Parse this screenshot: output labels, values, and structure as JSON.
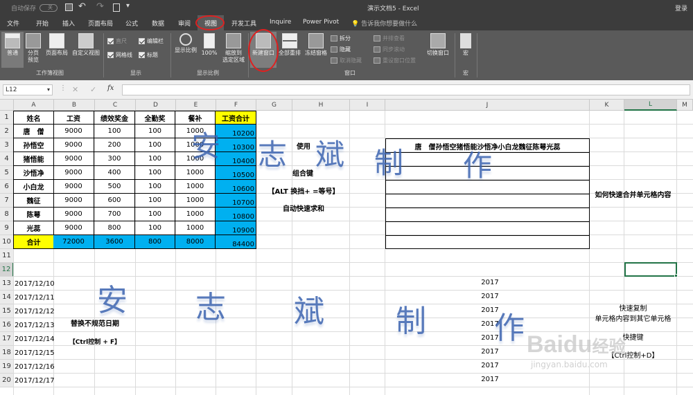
{
  "titlebar": {
    "autosave_label": "自动保存",
    "autosave_state": "关",
    "title": "演示文档5  -  Excel",
    "login": "登录"
  },
  "tabs": [
    {
      "label": "文件"
    },
    {
      "label": "开始"
    },
    {
      "label": "插入"
    },
    {
      "label": "页面布局"
    },
    {
      "label": "公式"
    },
    {
      "label": "数据"
    },
    {
      "label": "审阅"
    },
    {
      "label": "视图"
    },
    {
      "label": "开发工具"
    },
    {
      "label": "Inquire"
    },
    {
      "label": "Power Pivot"
    }
  ],
  "tellme": "告诉我你想要做什么",
  "ribbon": {
    "workbook_views": {
      "group": "工作簿视图",
      "normal": "普通",
      "page_break": "分页\n预览",
      "page_layout": "页面布局",
      "custom": "自定义视图"
    },
    "show": {
      "group": "显示",
      "ruler": "直尺",
      "formula_bar": "编辑栏",
      "gridlines": "网格线",
      "headings": "标题"
    },
    "zoom": {
      "group": "显示比例",
      "zoom": "显示比例",
      "hundred": "100%",
      "to_selection": "缩放到\n选定区域"
    },
    "window": {
      "group": "窗口",
      "new_window": "新建窗口",
      "arrange_all": "全部重排",
      "freeze": "冻结窗格",
      "split": "拆分",
      "hide": "隐藏",
      "unhide": "取消隐藏",
      "side_by_side": "并排查看",
      "sync_scroll": "同步滚动",
      "reset_pos": "重设窗口位置",
      "switch": "切换窗口"
    },
    "macros": {
      "group": "宏",
      "macros": "宏"
    }
  },
  "formula_bar": {
    "name_box": "L12",
    "fx": "fx",
    "cancel": "✕",
    "enter": "✓"
  },
  "columns": [
    "A",
    "B",
    "C",
    "D",
    "E",
    "F",
    "G",
    "H",
    "I",
    "J",
    "K",
    "L",
    "M"
  ],
  "rows": [
    "1",
    "2",
    "3",
    "4",
    "5",
    "6",
    "7",
    "8",
    "9",
    "10",
    "11",
    "12",
    "13",
    "14",
    "15",
    "16",
    "17",
    "18",
    "19",
    "20"
  ],
  "table": {
    "headers": [
      "姓名",
      "工资",
      "绩效奖金",
      "全勤奖",
      "餐补",
      "工资合计"
    ],
    "rows": [
      [
        "唐　僧",
        "9000",
        "100",
        "100",
        "1000",
        "10200"
      ],
      [
        "孙悟空",
        "9000",
        "200",
        "100",
        "1000",
        "10300"
      ],
      [
        "猪悟能",
        "9000",
        "300",
        "100",
        "1000",
        "10400"
      ],
      [
        "沙悟净",
        "9000",
        "400",
        "100",
        "1000",
        "10500"
      ],
      [
        "小白龙",
        "9000",
        "500",
        "100",
        "1000",
        "10600"
      ],
      [
        "魏征",
        "9000",
        "600",
        "100",
        "1000",
        "10700"
      ],
      [
        "陈萼",
        "9000",
        "700",
        "100",
        "1000",
        "10800"
      ],
      [
        "光蕊",
        "9000",
        "800",
        "100",
        "1000",
        "10900"
      ]
    ],
    "total": [
      "合计",
      "72000",
      "3600",
      "800",
      "8000",
      "84400"
    ]
  },
  "notes": {
    "h3": "使用",
    "h4": "组合键",
    "h6": "【ALT 换挡+ =等号】",
    "h8": "自动快速求和",
    "j3": "唐　僧孙悟空猪悟能沙悟净小白龙魏征陈萼光蕊",
    "k7": "如何快速合并单元格内容",
    "b15": "替换不规范日期",
    "b17": "【Ctrl控制 + F】",
    "k14": "快速复制",
    "k15": "单元格内容到其它单元格",
    "k17": "快捷键",
    "k18": "【Ctrl控制+D】"
  },
  "dates": [
    "2017/12/10",
    "2017/12/11",
    "2017/12/12",
    "2017/12/13",
    "2017/12/14",
    "2017/12/15",
    "2017/12/16",
    "2017/12/17"
  ],
  "years": [
    "2017",
    "2017",
    "2017",
    "2017",
    "2017",
    "2017",
    "2017",
    "2017"
  ],
  "watermark": {
    "chars": [
      "安",
      "志",
      "斌",
      "制",
      "作"
    ],
    "baidu": "Baidu",
    "baidu_cn": "经验",
    "site": "jingyan.baidu.com"
  },
  "colors": {
    "accent": "#217346",
    "yellow": "#ffff00",
    "blue": "#00b0f0",
    "highlight": "#e02020"
  }
}
